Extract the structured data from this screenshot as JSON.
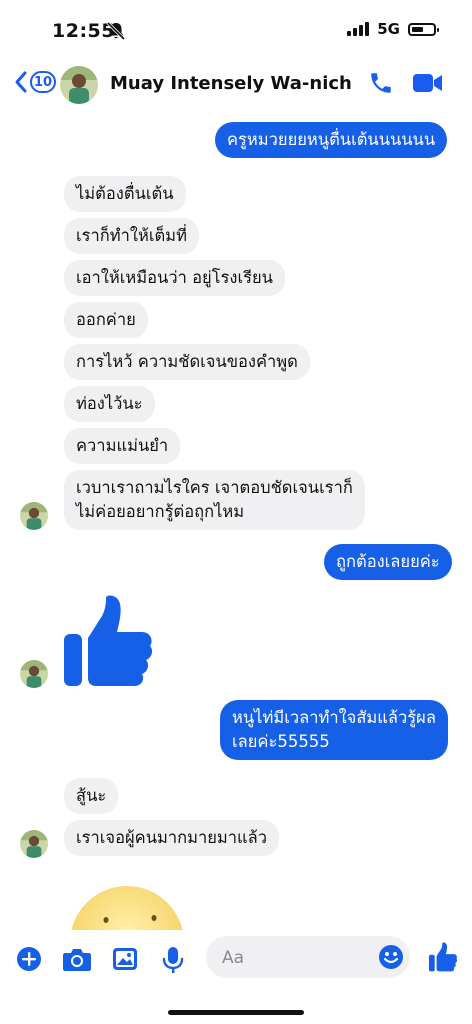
{
  "status": {
    "time": "12:55",
    "network": "5G"
  },
  "header": {
    "back_count": "10",
    "contact_name": "Muay Intensely Wa-nich"
  },
  "messages": [
    {
      "side": "out",
      "text": "ครูหมวยยยหนูตื่นเต้นนนนนน"
    },
    {
      "side": "in",
      "text": "ไม่ต้องตื่นเต้น"
    },
    {
      "side": "in",
      "text": "เราก็ทำให้เต็มที่"
    },
    {
      "side": "in",
      "text": "เอาให้เหมือนว่า อยู่โรงเรียน"
    },
    {
      "side": "in",
      "text": "ออกค่าย"
    },
    {
      "side": "in",
      "text": "การไหว้ ความชัดเจนของคำพูด"
    },
    {
      "side": "in",
      "text": "ท่องไว้นะ"
    },
    {
      "side": "in",
      "text": "ความแม่นยำ"
    },
    {
      "side": "in",
      "line1": "เวบาเราถามไรใคร เจาตอบชัดเจนเราก็",
      "line2": "ไม่ค่อยอยากรู้ต่อถุกไหม"
    },
    {
      "side": "out",
      "text": "ถูกต้องเลยยค่ะ"
    },
    {
      "side": "out",
      "line1": "หนูไท่มีเวลาทำใจสัมแล้วรู้ผล",
      "line2": "เลยค่ะ55555"
    },
    {
      "side": "in",
      "text": "สู้นะ"
    },
    {
      "side": "in",
      "text": "เราเจอผู้คนมากมายมาแล้ว"
    }
  ],
  "composer": {
    "placeholder": "Aa"
  },
  "colors": {
    "accent": "#1660e8",
    "incoming_bubble": "#f0f0f2"
  },
  "icons": [
    "bell-off-icon",
    "signal-icon",
    "battery-icon",
    "back-chevron-icon",
    "phone-icon",
    "video-camera-icon",
    "thumbs-up-icon",
    "plus-icon",
    "camera-icon",
    "image-icon",
    "microphone-icon",
    "emoji-icon"
  ]
}
